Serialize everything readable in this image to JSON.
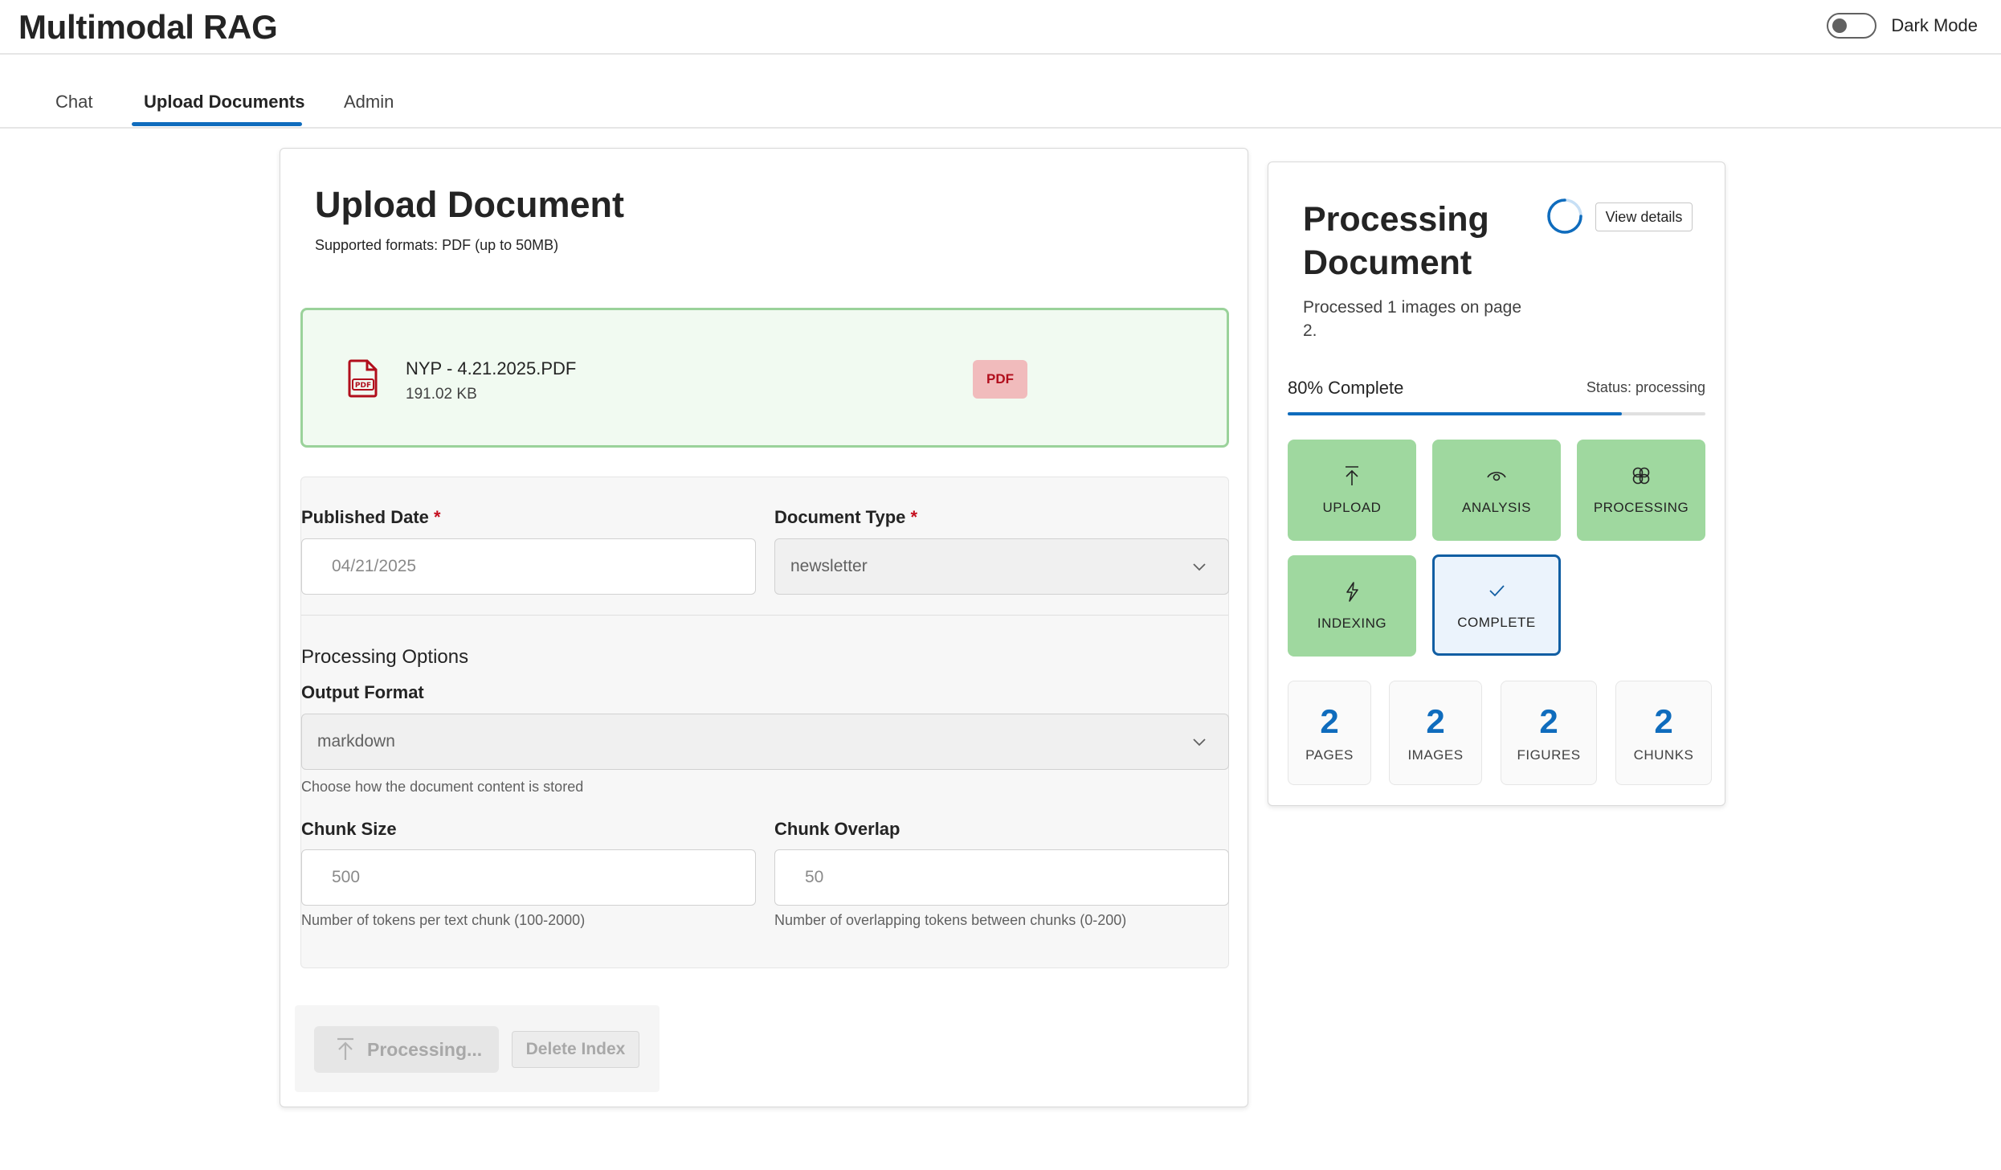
{
  "app": {
    "title": "Multimodal RAG",
    "dark_mode_label": "Dark Mode",
    "dark_mode_on": false
  },
  "tabs": [
    {
      "label": "Chat",
      "active": false
    },
    {
      "label": "Upload Documents",
      "active": true
    },
    {
      "label": "Admin",
      "active": false
    }
  ],
  "upload": {
    "title": "Upload Document",
    "subtitle": "Supported formats: PDF (up to 50MB)",
    "file": {
      "icon": "pdf-file-icon",
      "name": "NYP - 4.21.2025.PDF",
      "size": "191.02 KB",
      "badge": "PDF"
    },
    "form": {
      "published_date": {
        "label": "Published Date",
        "required_mark": "*",
        "value": "04/21/2025"
      },
      "document_type": {
        "label": "Document Type",
        "required_mark": "*",
        "value": "newsletter"
      },
      "processing_options_heading": "Processing Options",
      "output_format": {
        "label": "Output Format",
        "value": "markdown",
        "hint": "Choose how the document content is stored"
      },
      "chunk_size": {
        "label": "Chunk Size",
        "value": "500",
        "hint": "Number of tokens per text chunk (100-2000)"
      },
      "chunk_overlap": {
        "label": "Chunk Overlap",
        "value": "50",
        "hint": "Number of overlapping tokens between chunks (0-200)"
      }
    },
    "buttons": {
      "process": "Processing...",
      "delete": "Delete Index"
    }
  },
  "processing": {
    "title": "Processing Document",
    "view_details": "View details",
    "message": "Processed 1 images on page 2.",
    "progress_text": "80% Complete",
    "progress_fraction": 0.8,
    "status_text": "Status: processing",
    "steps": [
      {
        "label": "UPLOAD",
        "icon": "arrow-up-icon",
        "state": "done"
      },
      {
        "label": "ANALYSIS",
        "icon": "eye-icon",
        "state": "done"
      },
      {
        "label": "PROCESSING",
        "icon": "brain-icon",
        "state": "done"
      },
      {
        "label": "INDEXING",
        "icon": "flash-icon",
        "state": "done"
      },
      {
        "label": "COMPLETE",
        "icon": "checkmark-icon",
        "state": "current"
      }
    ],
    "stats": [
      {
        "value": "2",
        "label": "PAGES"
      },
      {
        "value": "2",
        "label": "IMAGES"
      },
      {
        "value": "2",
        "label": "FIGURES"
      },
      {
        "value": "2",
        "label": "CHUNKS"
      }
    ]
  },
  "colors": {
    "accent": "#0f6cbd",
    "success_bg": "#9fd89f",
    "success_border": "#9ad29a",
    "pdf_badge_bg": "#f1bbbc",
    "pdf_red": "#b10e1c"
  }
}
